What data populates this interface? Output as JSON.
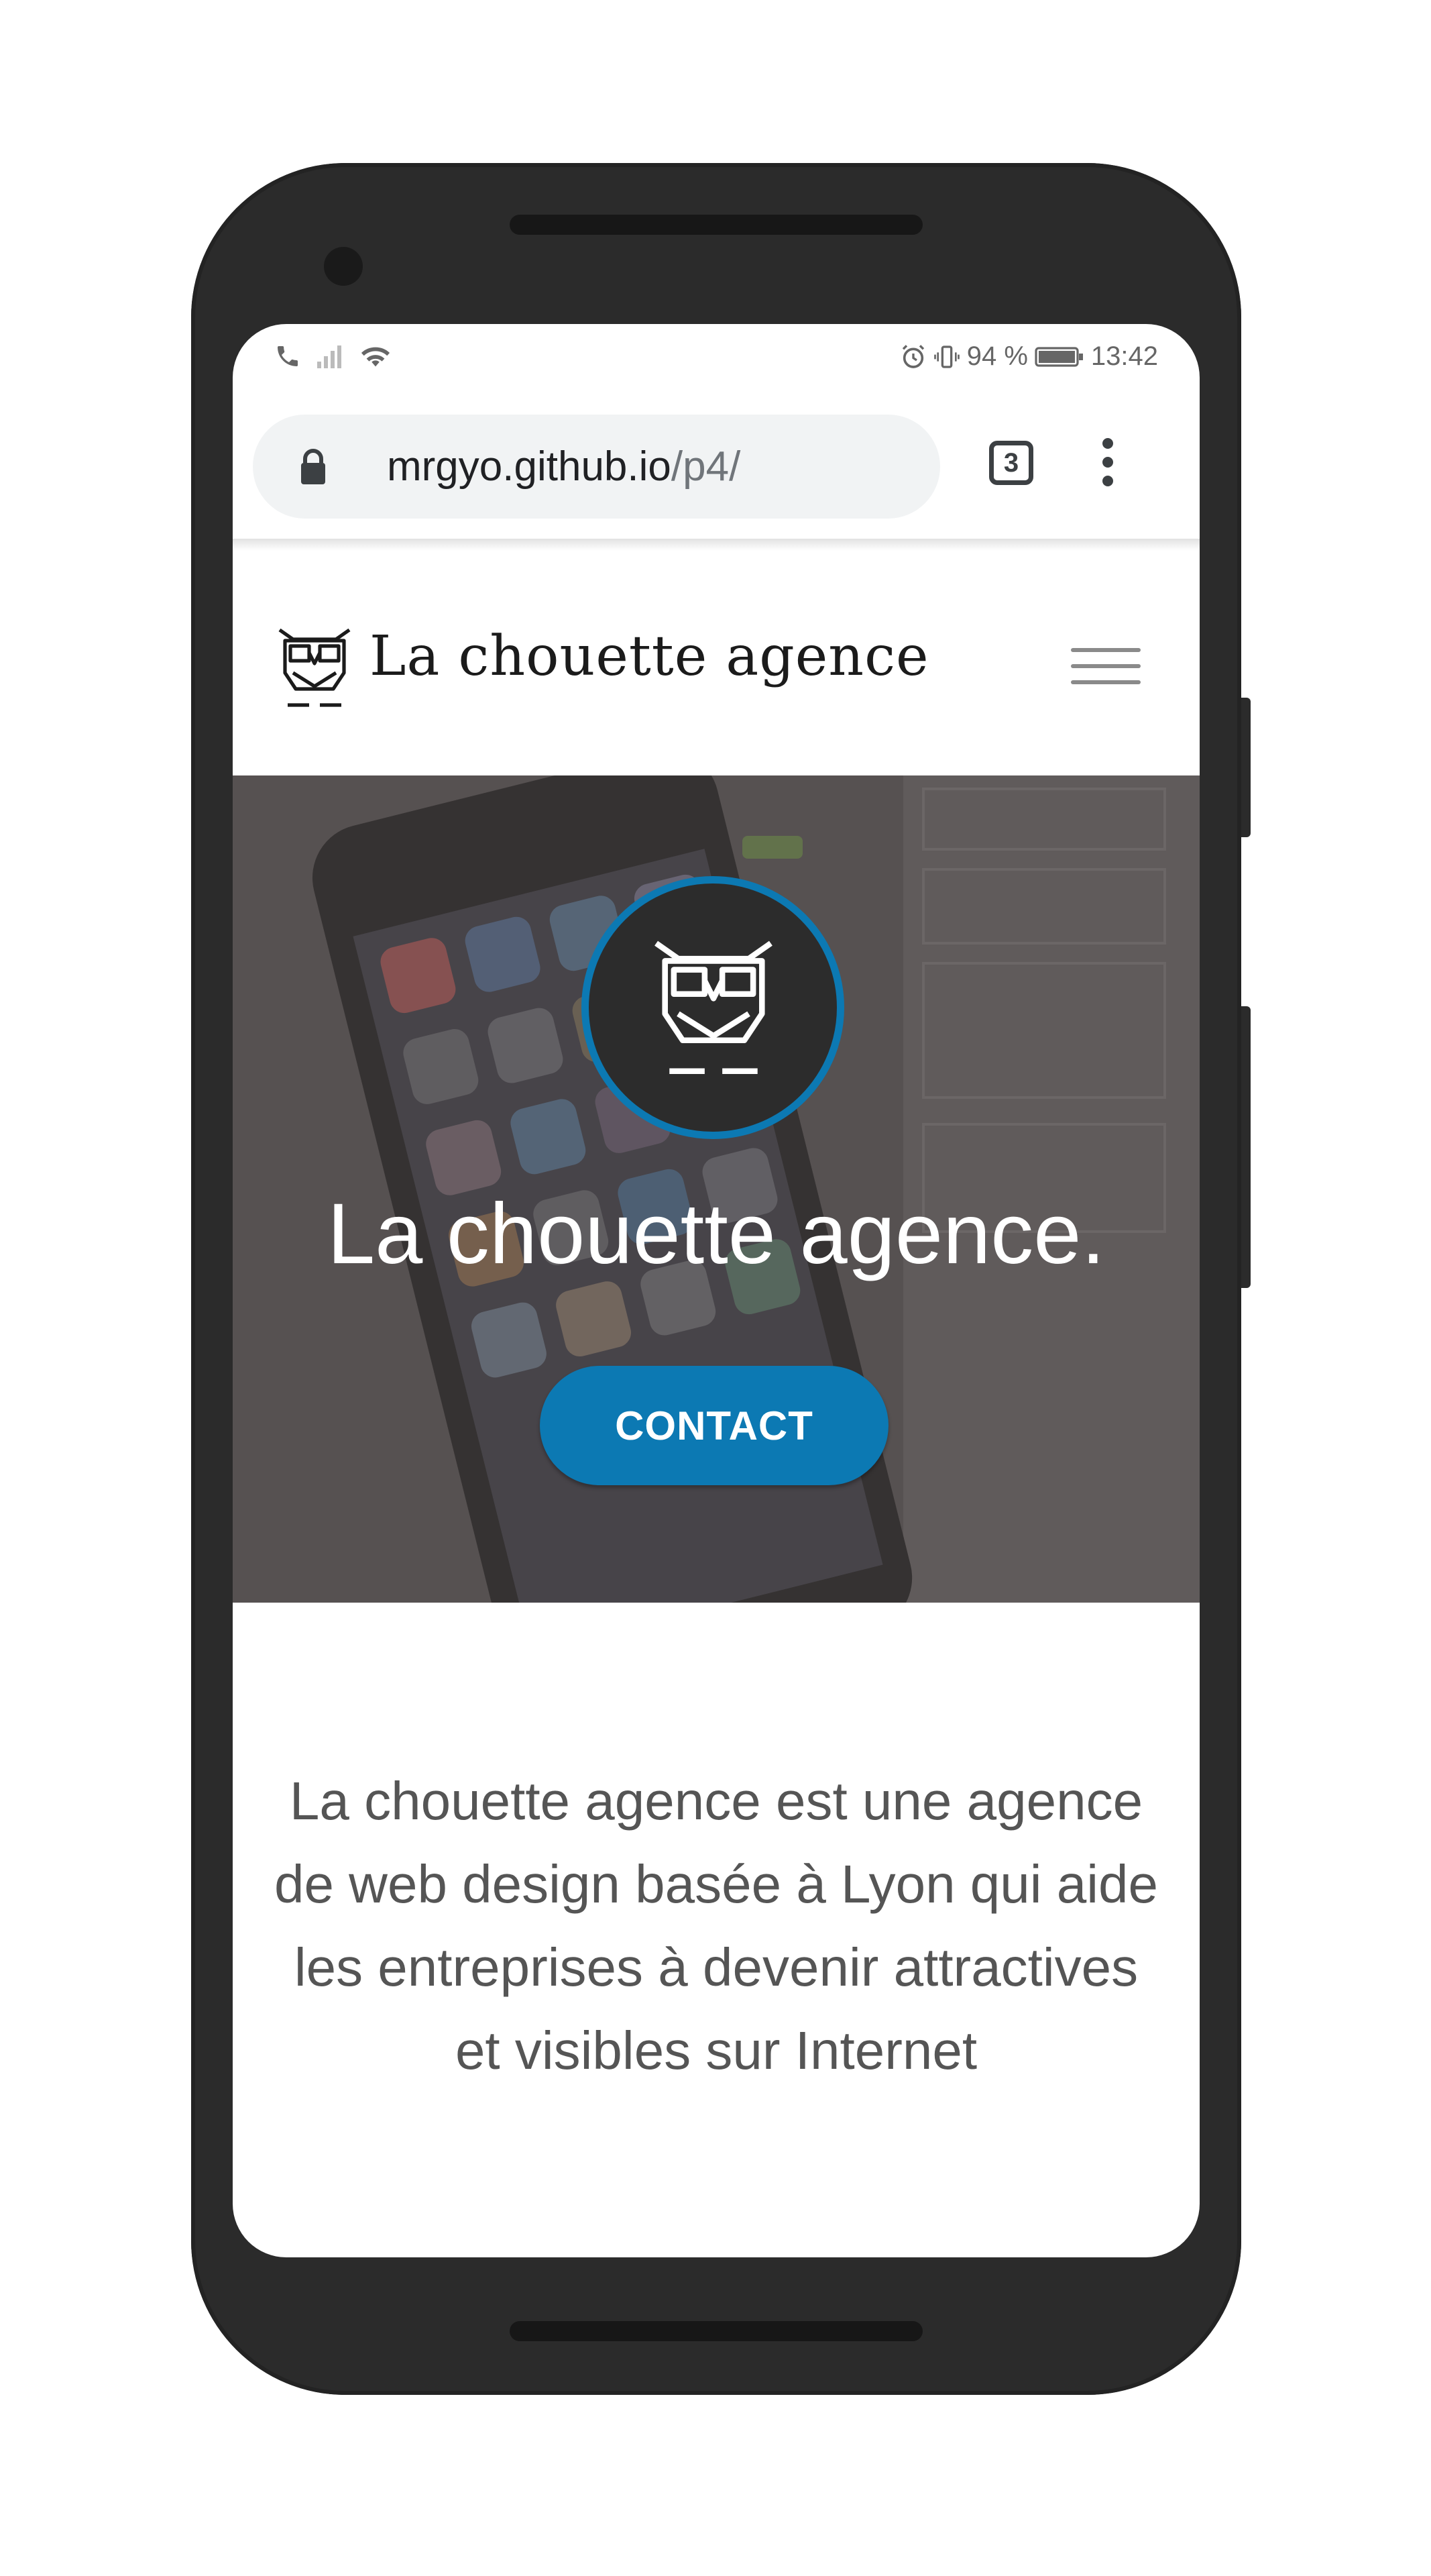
{
  "status_bar": {
    "battery": "94 %",
    "time": "13:42"
  },
  "browser": {
    "url_domain": "mrgyo.github.io",
    "url_path": "/p4/",
    "tab_count": "3"
  },
  "header": {
    "brand": "La chouette agence"
  },
  "hero": {
    "title": "La chouette agence.",
    "cta_label": "CONTACT"
  },
  "intro": {
    "text": "La chouette agence est une agence de web design basée à Lyon qui aide les entreprises à devenir attractives et visibles sur Internet"
  },
  "colors": {
    "accent": "#0c79b3",
    "badge_bg": "#2c2c2c",
    "body_text": "#555555"
  },
  "icons": [
    "phone-icon",
    "signal-icon",
    "wifi-icon",
    "alarm-icon",
    "vibrate-icon",
    "battery-icon",
    "lock-icon",
    "tabs-icon",
    "menu-dots-icon",
    "owl-logo-icon",
    "hamburger-icon"
  ]
}
